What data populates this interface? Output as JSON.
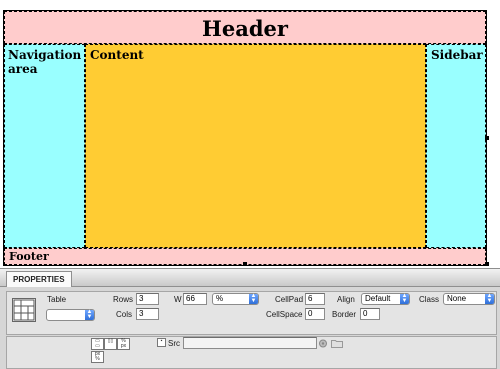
{
  "design_view": {
    "header": "Header",
    "navigation": "Navigation area",
    "content": "Content",
    "sidebar": "Sidebar",
    "footer": "Footer",
    "colors": {
      "header_footer": "#ffcccc",
      "side_columns": "#99ffff",
      "content": "#ffcc33"
    }
  },
  "properties": {
    "tab_label": "PROPERTIES",
    "table_label": "Table",
    "table_id_value": "",
    "rows_label": "Rows",
    "rows_value": "3",
    "cols_label": "Cols",
    "cols_value": "3",
    "width_label": "W",
    "width_value": "66",
    "width_unit": "%",
    "cellpad_label": "CellPad",
    "cellpad_value": "6",
    "cellspace_label": "CellSpace",
    "cellspace_value": "0",
    "align_label": "Align",
    "align_value": "Default",
    "border_label": "Border",
    "border_value": "0",
    "class_label": "Class",
    "class_value": "None",
    "src_label": "Src",
    "src_value": ""
  }
}
